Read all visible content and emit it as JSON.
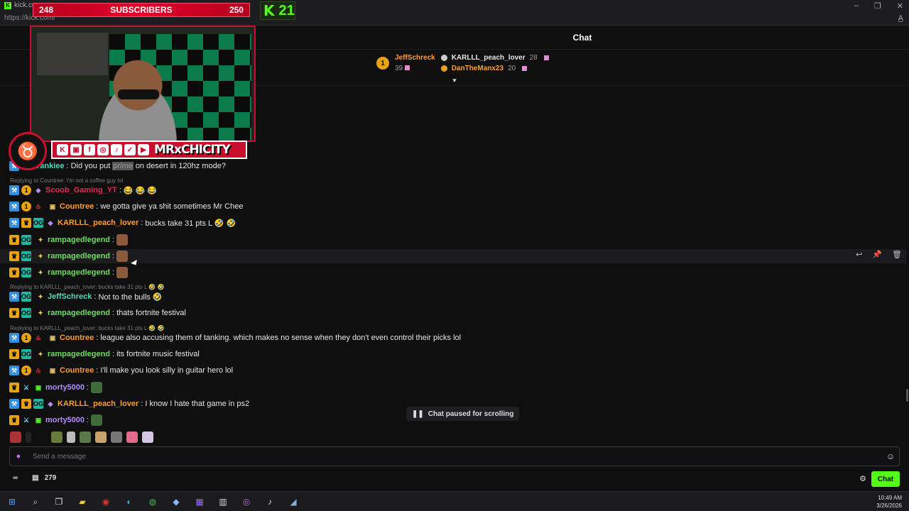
{
  "browser": {
    "tab_title": "kick.com",
    "url": "https://kick.com/",
    "controls": [
      "–",
      "❐",
      "✕"
    ]
  },
  "overlay": {
    "subs_left": "248",
    "subs_label": "SUBSCRIBERS",
    "subs_right": "250",
    "kick_count": "21",
    "channel_name": "MRxCHICITY"
  },
  "chat": {
    "title": "Chat",
    "leaderboard": {
      "rank": "1",
      "top_name": "JeffSchreck",
      "top_count": "39",
      "second_name": "KARLLL_peach_lover",
      "second_count": "28",
      "third_name": "DanTheManx23",
      "third_count": "20"
    },
    "messages": [
      {
        "user": "iclefrankiee",
        "pre": "Did you put",
        "blur": "prime",
        "post": "on desert in 120hz mode?",
        "color": "c-teal"
      },
      {
        "reply": "Replying to Countree: I'm not a coffee guy lol"
      },
      {
        "user": "Scoob_Gaming_YT",
        "text": "😂 😂 😂"
      },
      {
        "user": "Countree",
        "text": "we gotta give ya shit sometimes Mr Chee"
      },
      {
        "user": "KARLLL_peach_lover",
        "text": "bucks take 31 pts L 🤣 🤣"
      },
      {
        "user": "rampagedlegend"
      },
      {
        "user": "rampagedlegend"
      },
      {
        "user": "rampagedlegend"
      },
      {
        "reply": "Replying to KARLLL_peach_lover: bucks take 31 pts L 🤣 🤣"
      },
      {
        "user": "JeffSchreck",
        "text": "Not to the bulls 🤣"
      },
      {
        "user": "rampagedlegend",
        "text": "thats fortnite festival"
      },
      {
        "reply": "Replying to KARLLL_peach_lover: bucks take 31 pts L 🤣 🤣"
      },
      {
        "user": "Countree",
        "text": "league also accusing them of tanking. which makes no sense when they don't even control their picks lol"
      },
      {
        "user": "rampagedlegend",
        "text": "its fortnite music festival"
      },
      {
        "user": "Countree",
        "text": "I'll make you look silly in guitar hero lol"
      },
      {
        "user": "morty5000"
      },
      {
        "user": "KARLLL_peach_lover",
        "text": "I know I hate that game in ps2"
      },
      {
        "user": "morty5000"
      }
    ],
    "paused_text": "Chat paused for scrolling",
    "input_placeholder": "Send a message",
    "viewer_count": "279",
    "chat_button": "Chat"
  },
  "clock": {
    "time": "10:49 AM",
    "date": "3/26/2026"
  },
  "colors": {
    "accent": "#53fc18",
    "overlay_red": "#c8102e",
    "username_orange": "#ff9d2e",
    "username_green": "#6fdc63"
  }
}
